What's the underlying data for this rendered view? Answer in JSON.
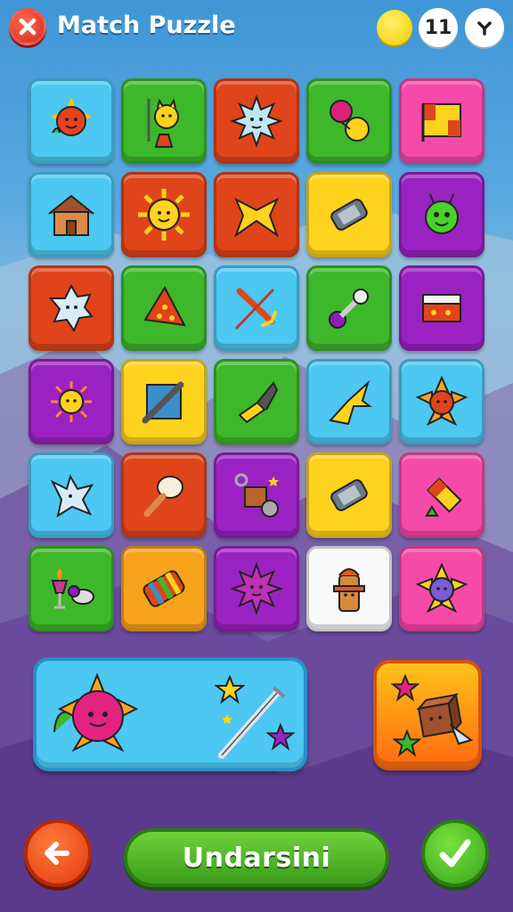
{
  "header": {
    "title": "Match Puzzle",
    "coin_icon": "coin-icon",
    "coin_count": "11"
  },
  "colors": {
    "blue": "#4cc8f2",
    "green": "#3cb82a",
    "red": "#e0441a",
    "pink": "#f64aa8",
    "yellow": "#ffd21e",
    "purple": "#9b22c2",
    "orange": "#f7a31c",
    "white": "#f9f9f9"
  },
  "grid": {
    "rows": [
      [
        {
          "color": "blue",
          "icon": "sun-creature-icon"
        },
        {
          "color": "green",
          "icon": "cat-with-fork-icon"
        },
        {
          "color": "red",
          "icon": "spiky-sun-icon"
        },
        {
          "color": "green",
          "icon": "balloons-icon"
        },
        {
          "color": "pink",
          "icon": "flag-icon"
        }
      ],
      [
        {
          "color": "blue",
          "icon": "house-icon"
        },
        {
          "color": "red",
          "icon": "sun-icon"
        },
        {
          "color": "red",
          "icon": "bow-icon"
        },
        {
          "color": "yellow",
          "icon": "tin-can-icon"
        },
        {
          "color": "purple",
          "icon": "green-alien-icon"
        }
      ],
      [
        {
          "color": "red",
          "icon": "spiky-ghost-icon"
        },
        {
          "color": "green",
          "icon": "pizza-slice-icon"
        },
        {
          "color": "blue",
          "icon": "arrow-icon"
        },
        {
          "color": "green",
          "icon": "dumbbell-icon"
        },
        {
          "color": "purple",
          "icon": "matchbox-icon"
        }
      ],
      [
        {
          "color": "purple",
          "icon": "sun-icon"
        },
        {
          "color": "yellow",
          "icon": "picture-frame-icon"
        },
        {
          "color": "green",
          "icon": "paintbrush-icon"
        },
        {
          "color": "blue",
          "icon": "bow-icon"
        },
        {
          "color": "blue",
          "icon": "flower-icon"
        }
      ],
      [
        {
          "color": "blue",
          "icon": "bird-icon"
        },
        {
          "color": "red",
          "icon": "maraca-icon"
        },
        {
          "color": "purple",
          "icon": "box-with-yarn-icon"
        },
        {
          "color": "yellow",
          "icon": "tin-can-icon"
        },
        {
          "color": "pink",
          "icon": "firecracker-icon"
        }
      ],
      [
        {
          "color": "green",
          "icon": "torch-goblet-icon"
        },
        {
          "color": "orange",
          "icon": "striped-can-icon"
        },
        {
          "color": "purple",
          "icon": "spiky-sun-icon"
        },
        {
          "color": "white",
          "icon": "fire-hydrant-icon"
        },
        {
          "color": "pink",
          "icon": "flower-face-icon"
        }
      ]
    ]
  },
  "bottom": {
    "big_panel_icons": [
      "snail-sun-icon",
      "star-icon",
      "magic-wand-icon",
      "star-icon"
    ],
    "small_panel_icons": [
      "star-icon",
      "box-with-wings-icon",
      "star-icon"
    ]
  },
  "footer": {
    "back_icon": "arrow-left-icon",
    "main_label": "Undarsini",
    "confirm_icon": "checkmark-icon"
  }
}
